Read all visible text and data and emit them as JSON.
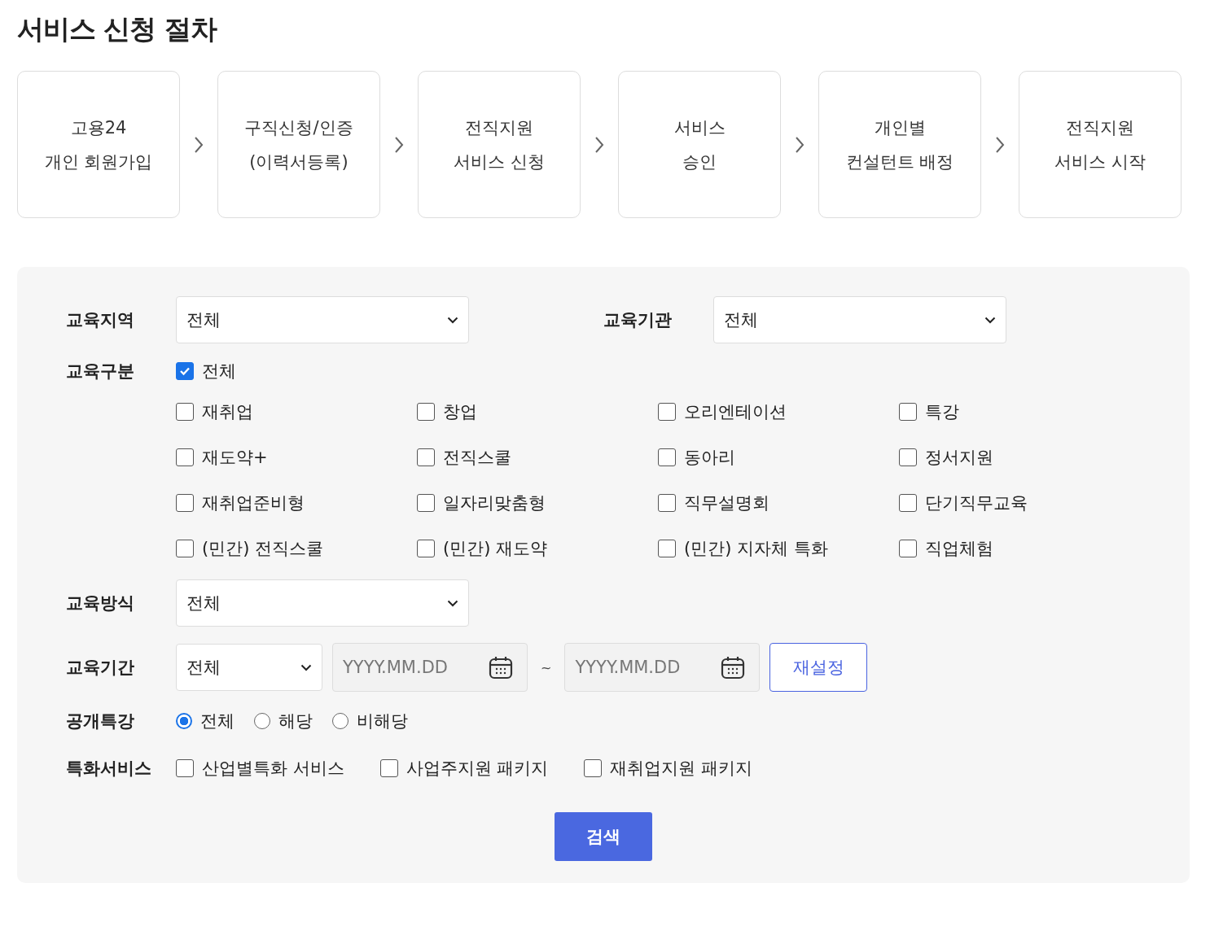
{
  "title": "서비스 신청 절차",
  "steps": [
    {
      "lines": [
        "고용24",
        "개인 회원가입"
      ]
    },
    {
      "lines": [
        "구직신청/인증",
        "(이력서등록)"
      ]
    },
    {
      "lines": [
        "전직지원",
        "서비스 신청"
      ]
    },
    {
      "lines": [
        "서비스",
        "승인"
      ]
    },
    {
      "lines": [
        "개인별",
        "컨설턴트 배정"
      ]
    },
    {
      "lines": [
        "전직지원",
        "서비스 시작"
      ]
    }
  ],
  "filters": {
    "region": {
      "label": "교육지역",
      "value": "전체"
    },
    "institution": {
      "label": "교육기관",
      "value": "전체"
    },
    "category": {
      "label": "교육구분",
      "all": {
        "label": "전체",
        "checked": true
      },
      "options": [
        {
          "label": "재취업",
          "checked": false
        },
        {
          "label": "창업",
          "checked": false
        },
        {
          "label": "오리엔테이션",
          "checked": false
        },
        {
          "label": "특강",
          "checked": false
        },
        {
          "label": "재도약+",
          "checked": false
        },
        {
          "label": "전직스쿨",
          "checked": false
        },
        {
          "label": "동아리",
          "checked": false
        },
        {
          "label": "정서지원",
          "checked": false
        },
        {
          "label": "재취업준비형",
          "checked": false
        },
        {
          "label": "일자리맞춤형",
          "checked": false
        },
        {
          "label": "직무설명회",
          "checked": false
        },
        {
          "label": "단기직무교육",
          "checked": false
        },
        {
          "label": "(민간) 전직스쿨",
          "checked": false
        },
        {
          "label": "(민간) 재도약",
          "checked": false
        },
        {
          "label": "(민간) 지자체 특화",
          "checked": false
        },
        {
          "label": "직업체험",
          "checked": false
        }
      ]
    },
    "method": {
      "label": "교육방식",
      "value": "전체"
    },
    "period": {
      "label": "교육기간",
      "range": "전체",
      "start_placeholder": "YYYY.MM.DD",
      "separator": "~",
      "end_placeholder": "YYYY.MM.DD",
      "reset": "재설정"
    },
    "open_lecture": {
      "label": "공개특강",
      "options": [
        {
          "label": "전체",
          "selected": true
        },
        {
          "label": "해당",
          "selected": false
        },
        {
          "label": "비해당",
          "selected": false
        }
      ]
    },
    "special": {
      "label": "특화서비스",
      "options": [
        {
          "label": "산업별특화 서비스",
          "checked": false
        },
        {
          "label": "사업주지원 패키지",
          "checked": false
        },
        {
          "label": "재취업지원 패키지",
          "checked": false
        }
      ]
    }
  },
  "search_button": "검색"
}
